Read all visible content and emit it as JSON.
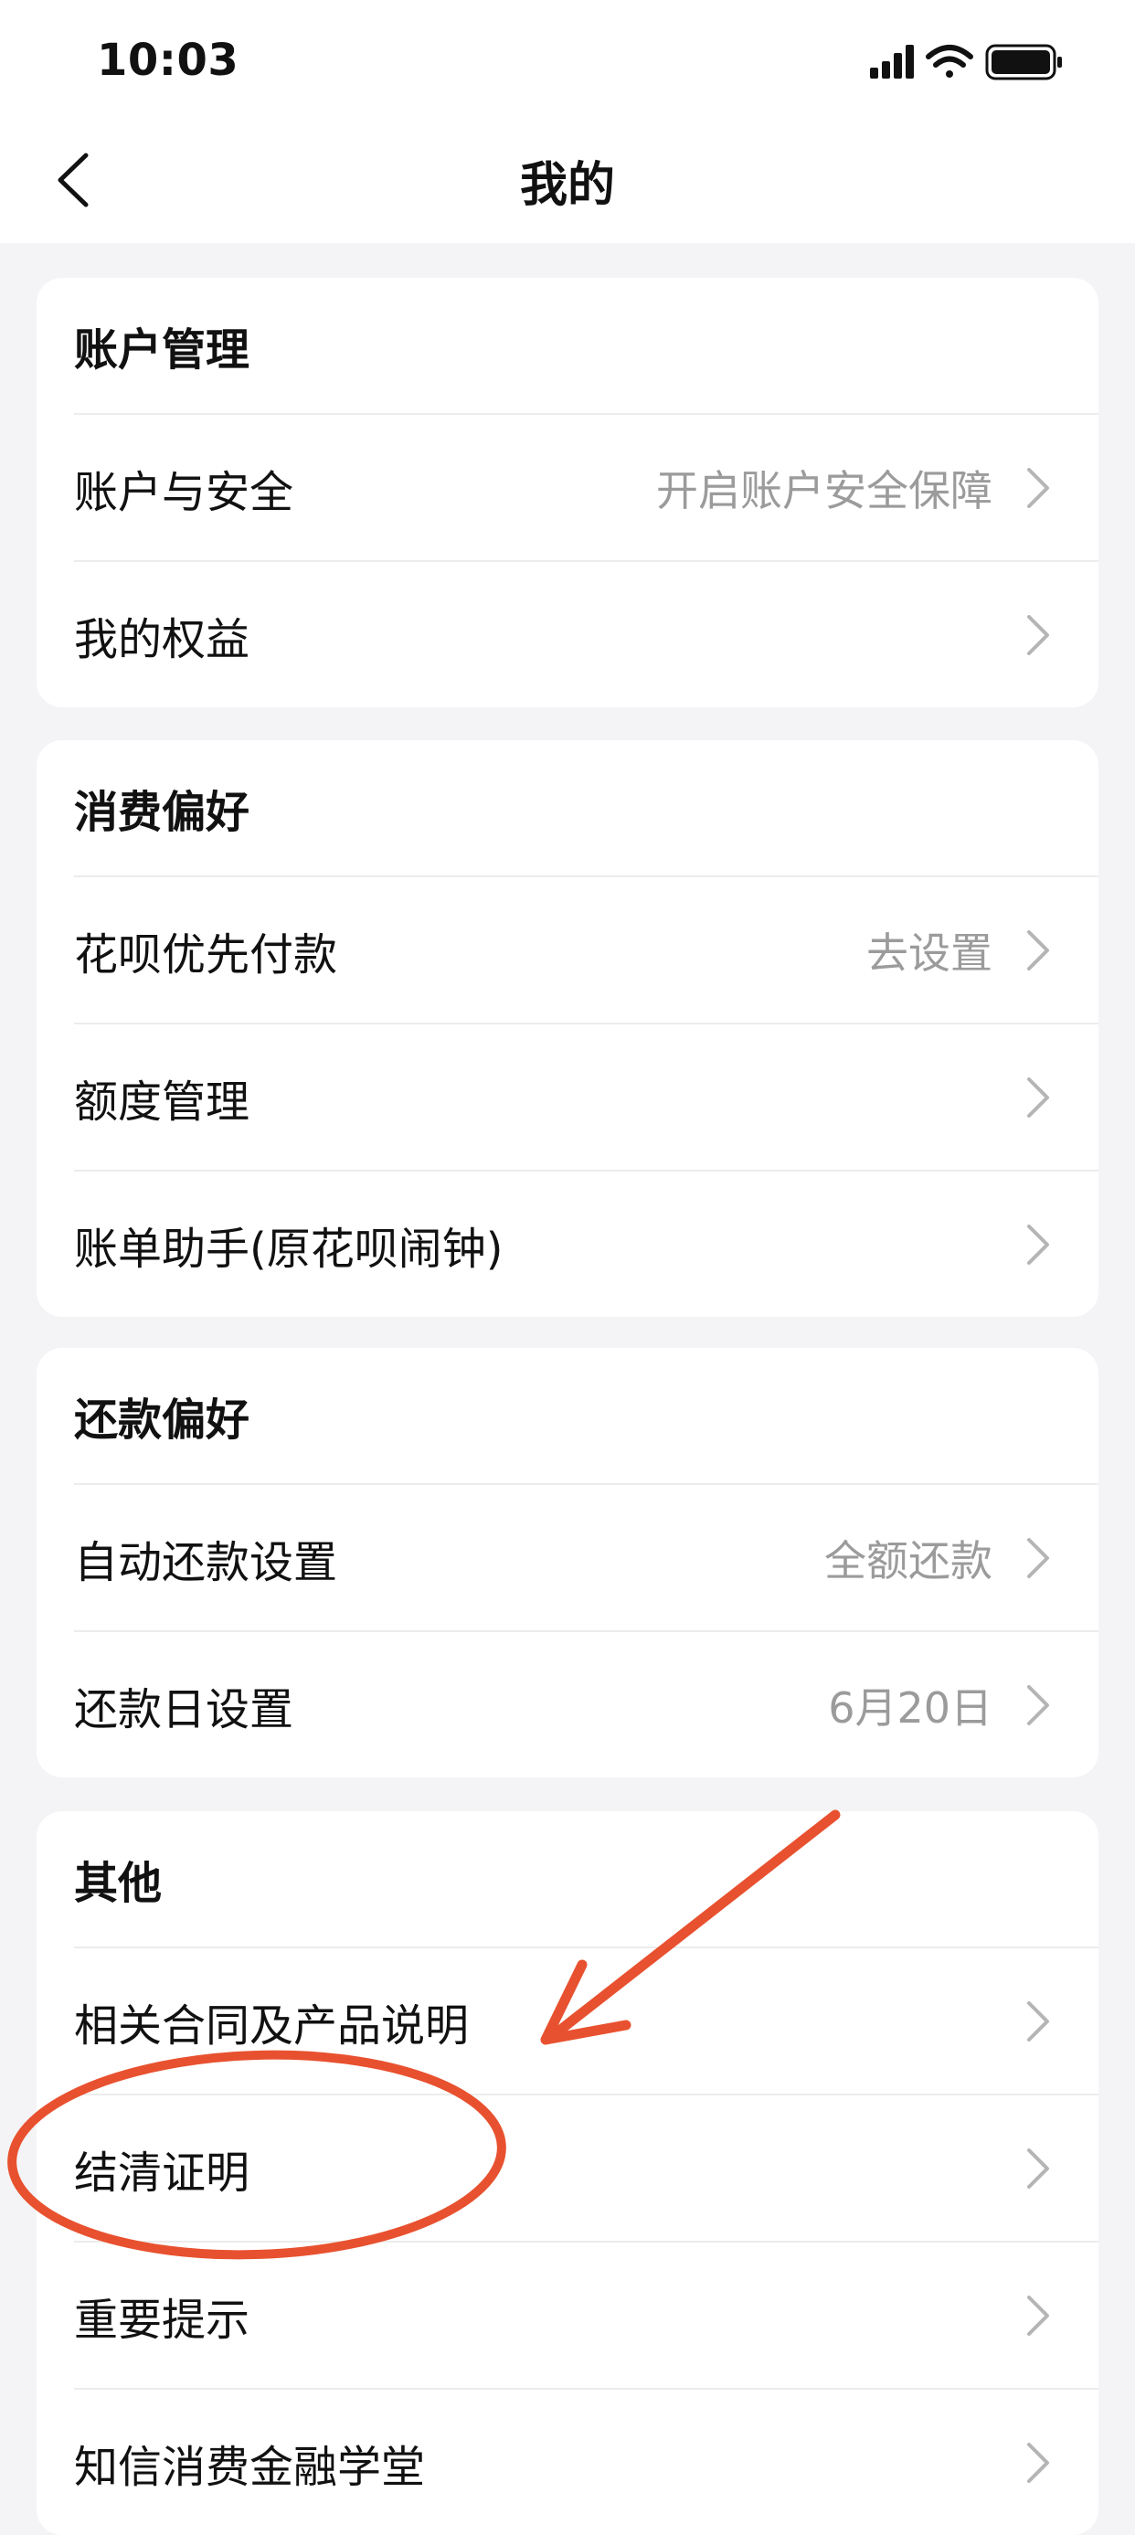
{
  "status_bar": {
    "time": "10:03"
  },
  "nav": {
    "title": "我的"
  },
  "sections": [
    {
      "title": "账户管理",
      "rows": [
        {
          "label": "账户与安全",
          "value": "开启账户安全保障"
        },
        {
          "label": "我的权益",
          "value": ""
        }
      ]
    },
    {
      "title": "消费偏好",
      "rows": [
        {
          "label": "花呗优先付款",
          "value": "去设置"
        },
        {
          "label": "额度管理",
          "value": ""
        },
        {
          "label": "账单助手(原花呗闹钟)",
          "value": ""
        }
      ]
    },
    {
      "title": "还款偏好",
      "rows": [
        {
          "label": "自动还款设置",
          "value": "全额还款"
        },
        {
          "label": "还款日设置",
          "value": "6月20日"
        }
      ]
    },
    {
      "title": "其他",
      "rows": [
        {
          "label": "相关合同及产品说明",
          "value": ""
        },
        {
          "label": "结清证明",
          "value": ""
        },
        {
          "label": "重要提示",
          "value": ""
        },
        {
          "label": "知信消费金融学堂",
          "value": ""
        }
      ]
    }
  ],
  "colors": {
    "background": "#f4f4f6",
    "card": "#ffffff",
    "annotation": "#e8512f",
    "secondary_text": "#9b9b9b"
  }
}
